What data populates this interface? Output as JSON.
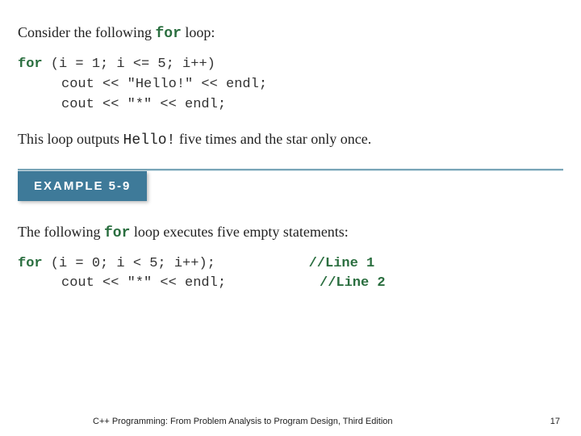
{
  "block1": {
    "intro_pre": "Consider the following ",
    "intro_kw": "for",
    "intro_post": " loop:",
    "code_kw": "for",
    "code_line1_rest": " (i = 1; i <= 5; i++)",
    "code_line2": "cout << \"Hello!\" << endl;",
    "code_line3": "cout << \"*\" << endl;",
    "outro_pre": "This loop outputs ",
    "outro_mono": "Hello!",
    "outro_post": " five times and the star only once."
  },
  "example_label": "EXAMPLE 5-9",
  "block2": {
    "intro_pre": "The following ",
    "intro_kw": "for",
    "intro_post": " loop executes five empty statements:",
    "code_kw": "for",
    "code_line1_rest": " (i = 0; i < 5; i++);",
    "code_line1_cmt": "//Line 1",
    "code_line2": "cout << \"*\" << endl;",
    "code_line2_cmt": "//Line 2"
  },
  "footer": {
    "text": "C++ Programming: From Problem Analysis to Program Design, Third Edition",
    "page": "17"
  }
}
